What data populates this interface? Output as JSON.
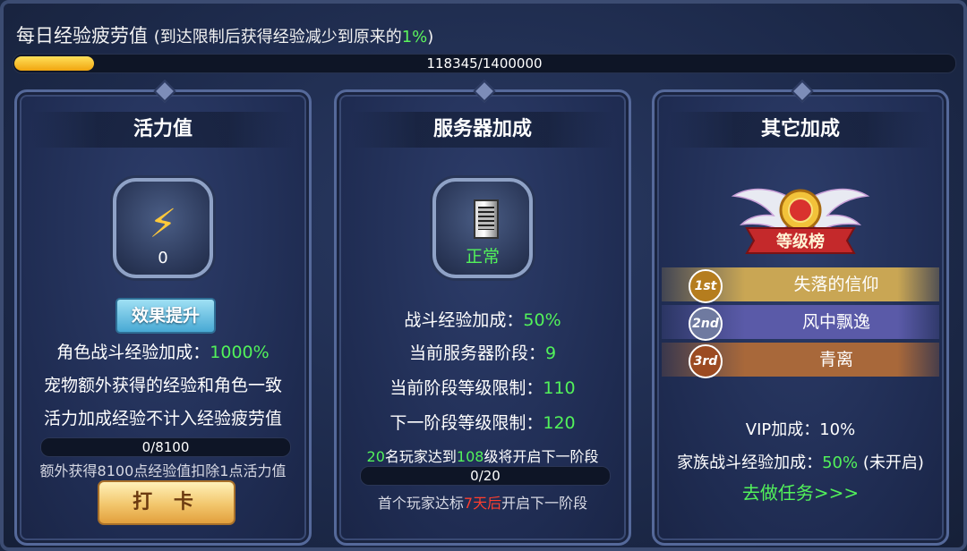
{
  "fatigue": {
    "title": "每日经验疲劳值",
    "note_prefix": "(到达限制后获得经验减少到原来的",
    "note_pct": "1%",
    "note_suffix": ")",
    "progress_text": "118345/1400000",
    "progress_value": 118345,
    "progress_max": 1400000
  },
  "vitality": {
    "title": "活力值",
    "icon": "lightning-icon",
    "value": "0",
    "boost_button": "效果提升",
    "line1_label": "角色战斗经验加成：",
    "line1_value": "1000%",
    "line2": "宠物额外获得的经验和角色一致",
    "line3": "活力加成经验不计入经验疲劳值",
    "bar_text": "0/8100",
    "bar_value": 0,
    "bar_max": 8100,
    "footnote": "额外获得8100点经验值扣除1点活力值",
    "checkin_button": "打 卡"
  },
  "server": {
    "title": "服务器加成",
    "icon": "server-icon",
    "status": "正常",
    "rows": [
      {
        "label": "战斗经验加成：",
        "value": "50%"
      },
      {
        "label": "当前服务器阶段：",
        "value": "9"
      },
      {
        "label": "当前阶段等级限制：",
        "value": "110"
      },
      {
        "label": "下一阶段等级限制：",
        "value": "120"
      }
    ],
    "progress_note": {
      "num1": "20",
      "mid": "名玩家达到",
      "num2": "108",
      "end": "级将开启下一阶段"
    },
    "bar_text": "0/20",
    "bar_value": 0,
    "bar_max": 20,
    "first_note": {
      "pre": "首个玩家达标",
      "days": "7天后",
      "post": "开启下一阶段"
    }
  },
  "other": {
    "title": "其它加成",
    "badge_label": "等级榜",
    "ranks": [
      {
        "medal": "1st",
        "name": "失落的信仰",
        "color": "#c9a654"
      },
      {
        "medal": "2nd",
        "name": "风中飘逸",
        "color": "#5a5aa8"
      },
      {
        "medal": "3rd",
        "name": "青离",
        "color": "#a8683a"
      }
    ],
    "vip_line": "VIP加成：10%",
    "family": {
      "label": "家族战斗经验加成：",
      "value": "50%",
      "status": "(未开启)"
    },
    "task_link": "去做任务>>>"
  },
  "colors": {
    "accent_green": "#52f25a",
    "accent_red": "#ff3e2e",
    "gold_bar": "#f1a50f"
  }
}
